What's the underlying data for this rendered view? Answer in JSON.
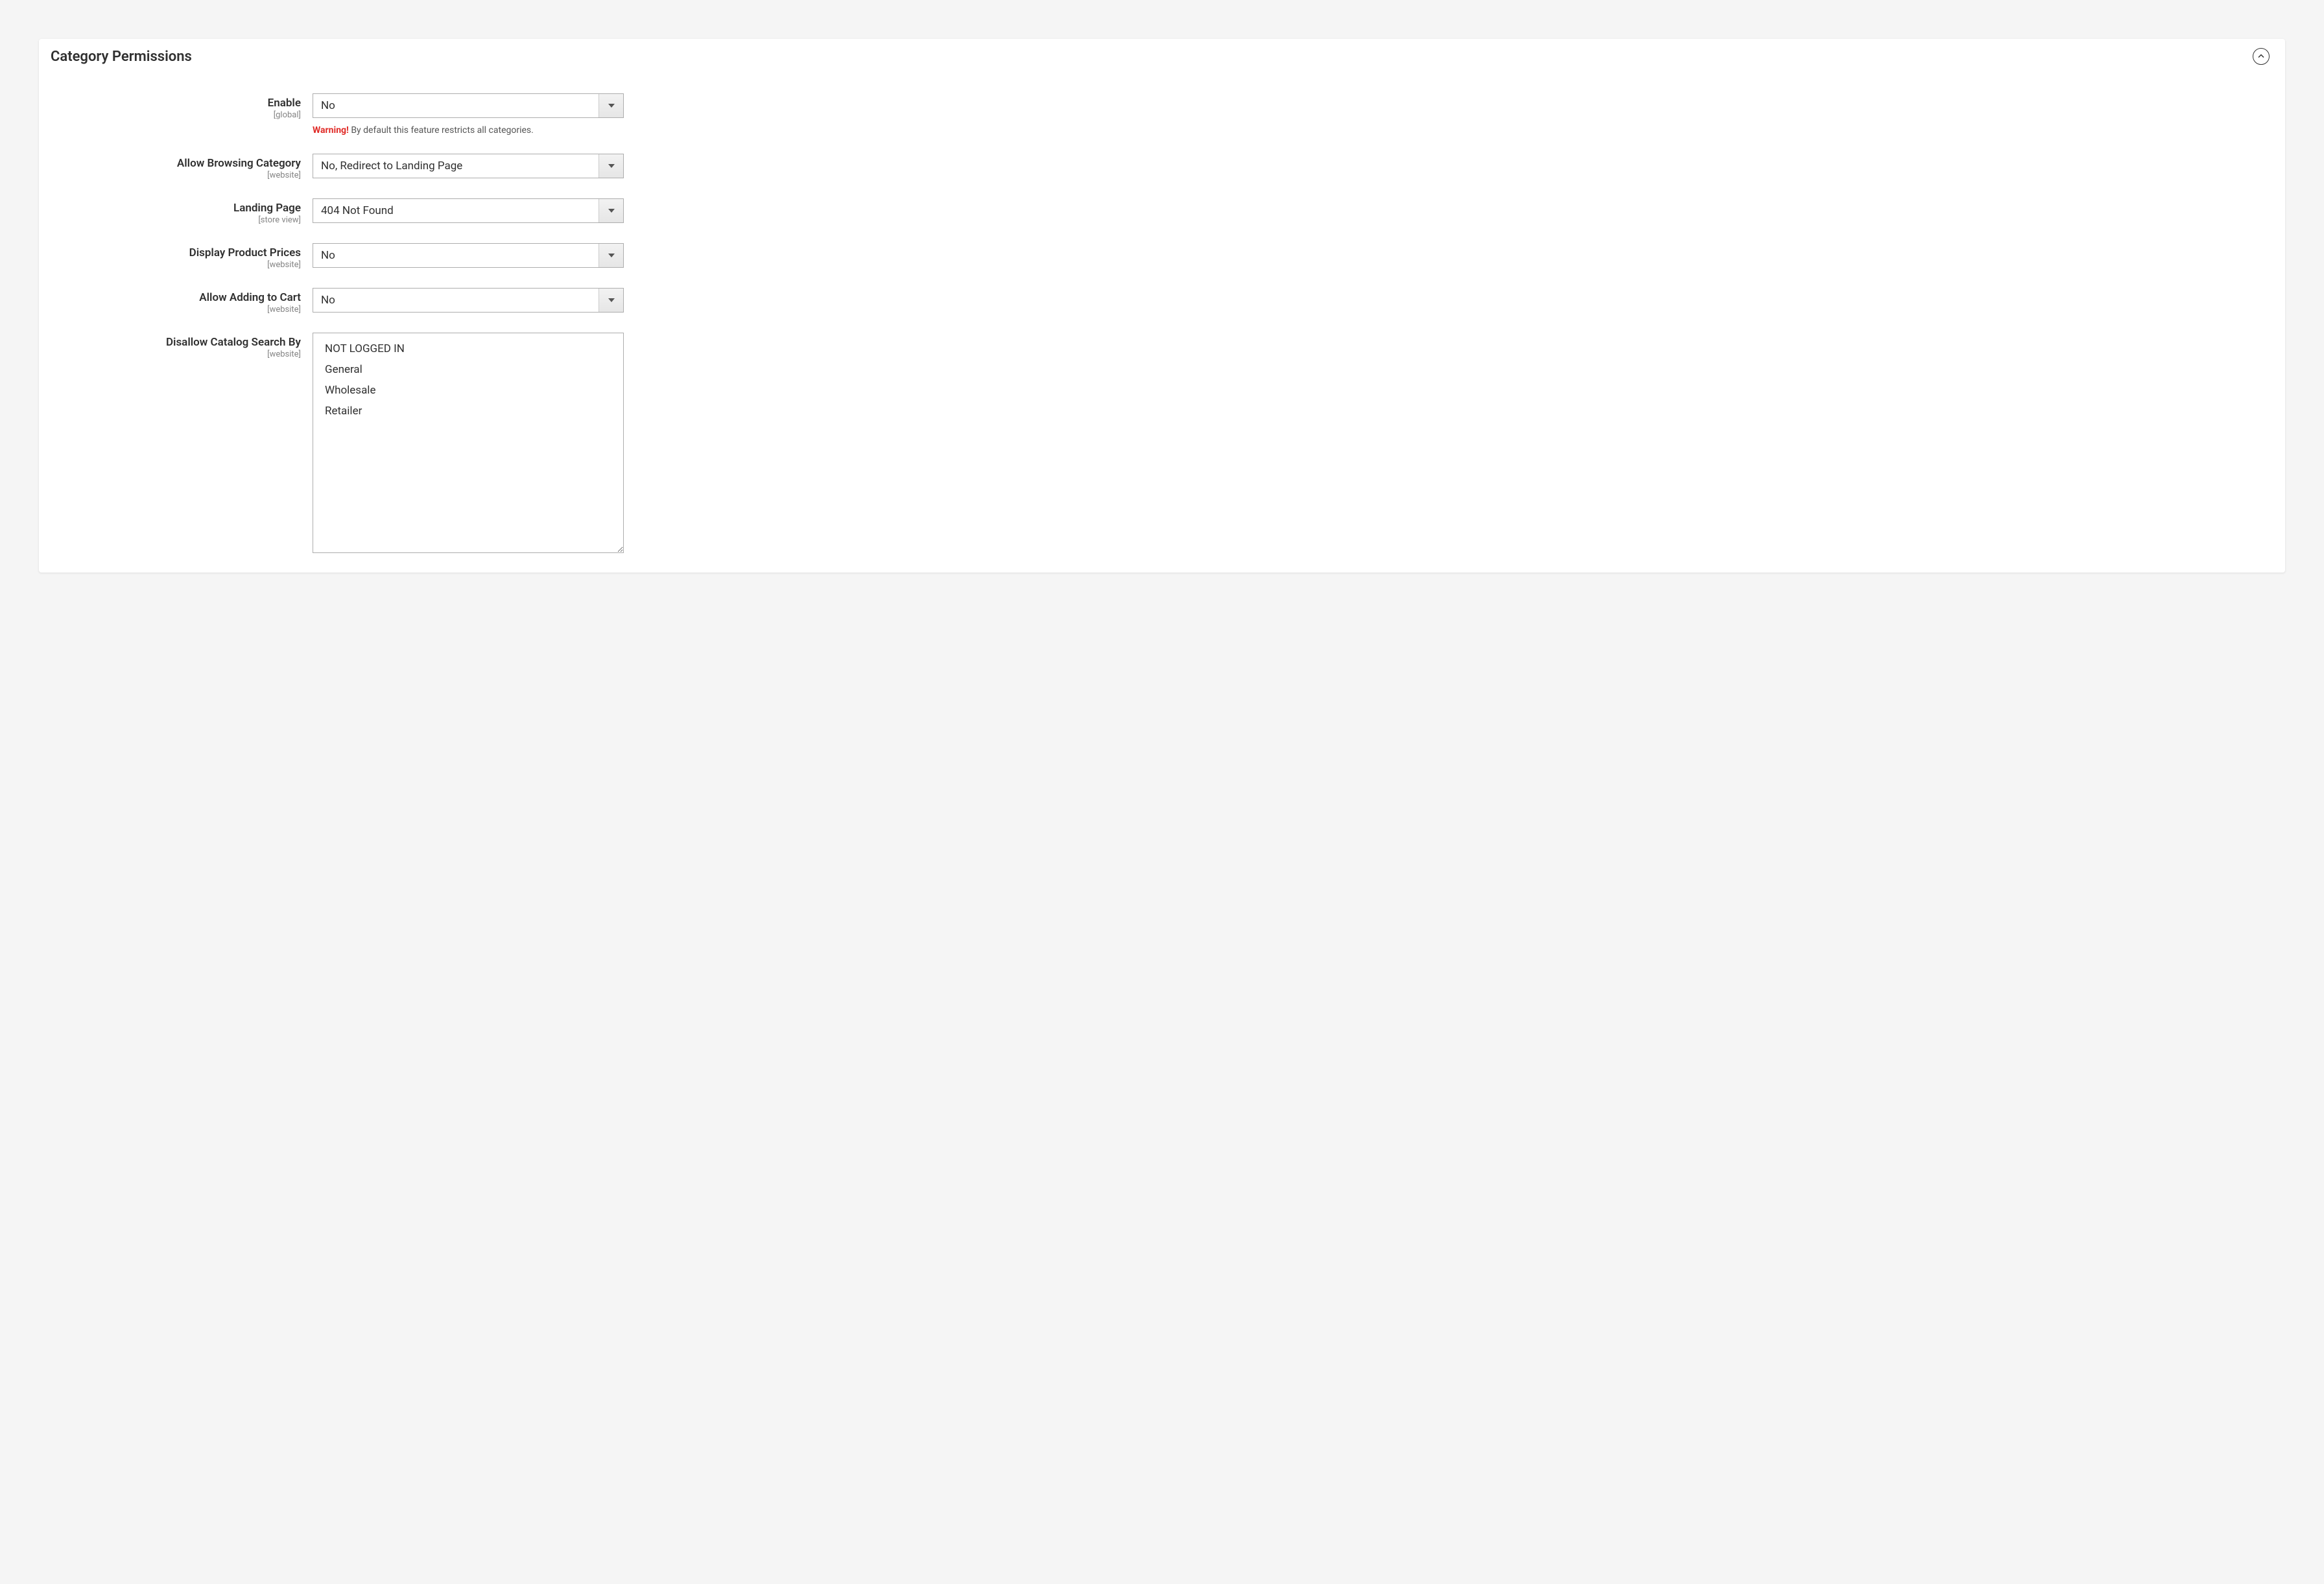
{
  "panel": {
    "title": "Category Permissions"
  },
  "fields": {
    "enable": {
      "label": "Enable",
      "scope": "[global]",
      "value": "No",
      "help_prefix": "Warning!",
      "help_text": " By default this feature restricts all categories."
    },
    "allow_browsing": {
      "label": "Allow Browsing Category",
      "scope": "[website]",
      "value": "No, Redirect to Landing Page"
    },
    "landing_page": {
      "label": "Landing Page",
      "scope": "[store view]",
      "value": "404 Not Found"
    },
    "display_prices": {
      "label": "Display Product Prices",
      "scope": "[website]",
      "value": "No"
    },
    "allow_cart": {
      "label": "Allow Adding to Cart",
      "scope": "[website]",
      "value": "No"
    },
    "disallow_search": {
      "label": "Disallow Catalog Search By",
      "scope": "[website]",
      "options": {
        "0": "NOT LOGGED IN",
        "1": "General",
        "2": "Wholesale",
        "3": "Retailer"
      }
    }
  }
}
